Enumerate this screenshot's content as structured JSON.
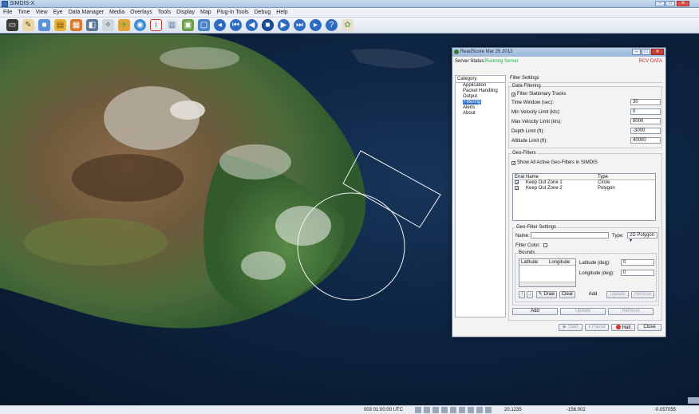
{
  "window": {
    "title": "SIMDIS-X",
    "minimize": "–",
    "maximize": "□",
    "close": "✕"
  },
  "menu": [
    "File",
    "Time",
    "View",
    "Eye",
    "Data Manager",
    "Media",
    "Overlays",
    "Tools",
    "Display",
    "Map",
    "Plug-in Tools",
    "Debug",
    "Help"
  ],
  "toolbar_icons": [
    "monitor-icon",
    "pen-icon",
    "save-icon",
    "folder-icon",
    "grid-icon",
    "image-icon",
    "satellite-icon",
    "plane-icon",
    "globe-icon",
    "info-icon",
    "chart-icon",
    "screen-icon",
    "comment-icon",
    "rewind-icon",
    "step-back-icon",
    "play-back-icon",
    "stop-icon",
    "play-forward-icon",
    "step-forward-icon",
    "fast-forward-icon",
    "help-icon",
    "palette-icon"
  ],
  "status": {
    "time": "003 01:00:00 UTC",
    "value1": "20.1235",
    "value2": "-156.002",
    "value3": "-0.057055"
  },
  "dialog": {
    "title": "ReadScore Mar 25 2013",
    "server_status_label": "Server Status:",
    "server_status_value": "Running Server",
    "rcv_label": "RCV DATA",
    "category_header": "Category",
    "categories": [
      "Application",
      "Packet Handling",
      "Output",
      "Filtering",
      "Alerts",
      "About"
    ],
    "selected_category": "Filtering",
    "filter_header": "Filter Settings",
    "data_filtering": {
      "title": "Data Filtering",
      "stationary_label": "Filter Stationary Tracks",
      "stationary_checked": true,
      "fields": [
        {
          "label": "Time Window (sec):",
          "value": "30"
        },
        {
          "label": "Min Velocity Limit (kts):",
          "value": "0"
        },
        {
          "label": "Max Velocity Limit (kts):",
          "value": "8000"
        },
        {
          "label": "Depth Limit (ft):",
          "value": "-3000"
        },
        {
          "label": "Altitude Limit (ft):",
          "value": "40000"
        }
      ]
    },
    "geo_filters": {
      "title": "Geo-Filters",
      "show_all_label": "Show All Active Geo-Filters in SIMDIS",
      "show_all_checked": true,
      "columns": [
        "Enal",
        "Name",
        "Type"
      ],
      "rows": [
        {
          "enabled": true,
          "name": "Keep Out Zone 1",
          "type": "Circle"
        },
        {
          "enabled": true,
          "name": "Keep Out Zone 2",
          "type": "Polygon"
        }
      ]
    },
    "geo_filter_settings": {
      "title": "Geo-Filter Settings",
      "name_label": "Name:",
      "name_value": "",
      "type_label": "Type:",
      "type_value": "2D Polygon",
      "filter_color_label": "Filter Color:",
      "bounds_title": "Bounds",
      "bounds_columns": [
        "Latitude",
        "Longitude"
      ],
      "lat_label": "Latitude (deg):",
      "lat_value": "0",
      "lon_label": "Longitude (deg):",
      "lon_value": "0",
      "draw_label": "Draw",
      "clear_label": "Clear",
      "add_label": "Add",
      "update_label": "Update",
      "remove_label": "Remove"
    },
    "bottom_buttons": {
      "add": "Add",
      "update": "Update",
      "remove": "Remove"
    },
    "footer": {
      "start": "Start",
      "pause": "Pause",
      "halt": "Halt",
      "close": "Close"
    }
  }
}
